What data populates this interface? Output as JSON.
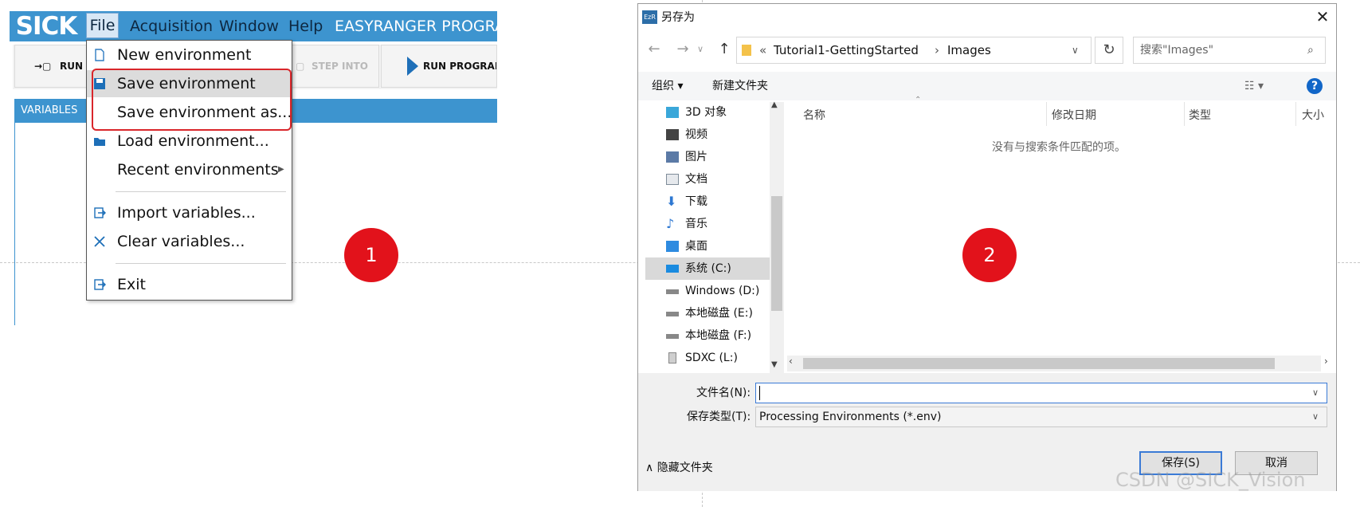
{
  "left_app": {
    "logo": "SICK",
    "menu": [
      "File",
      "Acquisition",
      "Window",
      "Help"
    ],
    "title": "EASYRANGER PROGRAM",
    "toolbar": {
      "run_step": "RUN S",
      "step_into": "STEP INTO",
      "run_program": "RUN PROGRAM"
    },
    "variables_header": "VARIABLES",
    "file_menu": {
      "items": [
        {
          "label": "New environment"
        },
        {
          "label": "Save environment"
        },
        {
          "label": "Save environment as..."
        },
        {
          "label": "Load environment..."
        },
        {
          "label": "Recent environments"
        },
        {
          "label": "Import variables..."
        },
        {
          "label": "Clear variables..."
        },
        {
          "label": "Exit"
        }
      ]
    },
    "step_badge": "1"
  },
  "dialog": {
    "title": "另存为",
    "app_icon": "EzR",
    "breadcrumb": [
      "«",
      "Tutorial1-GettingStarted",
      "Images"
    ],
    "search_placeholder": "搜索\"Images\"",
    "cmd_organize": "组织 ▾",
    "cmd_new_folder": "新建文件夹",
    "help": "?",
    "nav_items": [
      {
        "label": "3D 对象",
        "icon": "3d-objects-icon",
        "color": "#3aa7d9"
      },
      {
        "label": "视频",
        "icon": "video-icon",
        "color": "#444444"
      },
      {
        "label": "图片",
        "icon": "pictures-icon",
        "color": "#5b7aa6"
      },
      {
        "label": "文档",
        "icon": "documents-icon",
        "color": "#7f8c99"
      },
      {
        "label": "下载",
        "icon": "downloads-icon",
        "color": "#2e78d2"
      },
      {
        "label": "音乐",
        "icon": "music-icon",
        "color": "#2e78d2"
      },
      {
        "label": "桌面",
        "icon": "desktop-icon",
        "color": "#2e8be0"
      },
      {
        "label": "系统 (C:)",
        "icon": "drive-c-icon",
        "color": "#1a8be0"
      },
      {
        "label": "Windows (D:)",
        "icon": "drive-icon",
        "color": "#888888"
      },
      {
        "label": "本地磁盘 (E:)",
        "icon": "drive-icon",
        "color": "#888888"
      },
      {
        "label": "本地磁盘 (F:)",
        "icon": "drive-icon",
        "color": "#888888"
      },
      {
        "label": "SDXC (L:)",
        "icon": "sd-card-icon",
        "color": "#888888"
      }
    ],
    "columns": [
      "名称",
      "修改日期",
      "类型",
      "大小"
    ],
    "empty_message": "没有与搜索条件匹配的项。",
    "filename_label": "文件名(N):",
    "filename_value": "",
    "filetype_label": "保存类型(T):",
    "filetype_value": "Processing Environments (*.env)",
    "hide_folders": "隐藏文件夹",
    "save_button": "保存(S)",
    "cancel_button": "取消",
    "step_badge": "2"
  },
  "watermark": "CSDN @SICK_Vision"
}
